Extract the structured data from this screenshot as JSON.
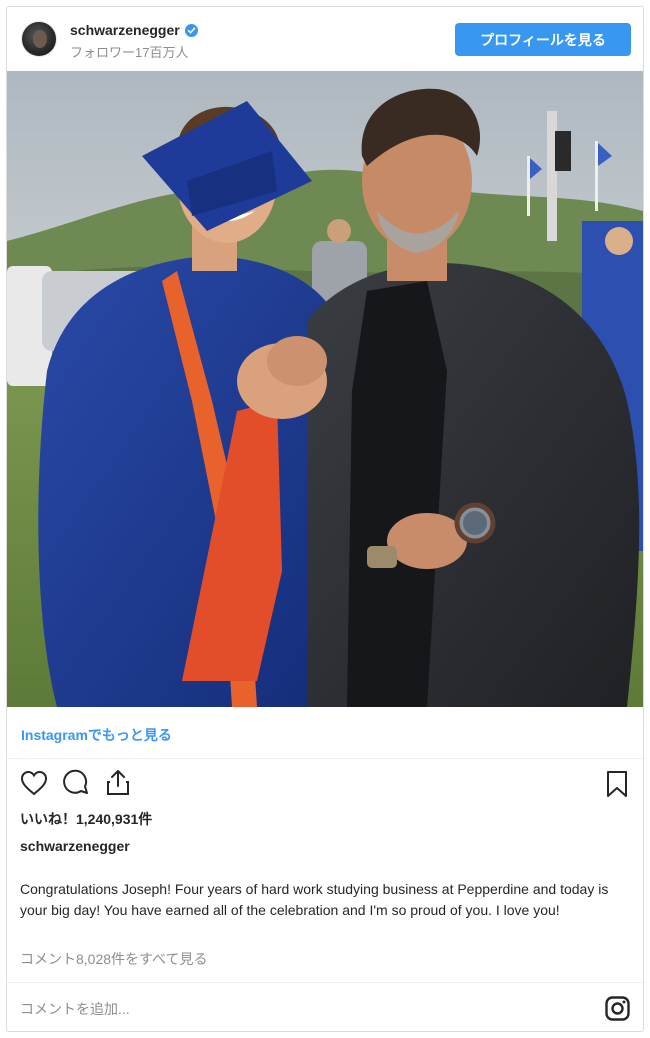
{
  "header": {
    "username": "schwarzenegger",
    "verified": true,
    "followers": "フォロワー17百万人",
    "profile_button": "プロフィールを見る"
  },
  "post": {
    "image_description_icon": "photo",
    "more_link": "Instagramでもっと見る",
    "actions": {
      "like_icon": "heart-icon",
      "comment_icon": "comment-icon",
      "share_icon": "share-icon",
      "save_icon": "bookmark-icon"
    },
    "likes": "いいね！1,240,931件",
    "caption_user": "schwarzenegger",
    "caption_text": "Congratulations Joseph! Four years of hard work studying business at Pepperdine and today is your big day! You have earned all of the celebration and I'm so proud of you. I love you!",
    "comments_link": "コメント8,028件をすべて見る",
    "comment_placeholder": "コメントを追加...",
    "footer_icon": "instagram-logo-icon"
  },
  "colors": {
    "accent": "#3897f0",
    "muted": "#8e8e8e",
    "text": "#262626",
    "border": "#dbdbdb"
  }
}
